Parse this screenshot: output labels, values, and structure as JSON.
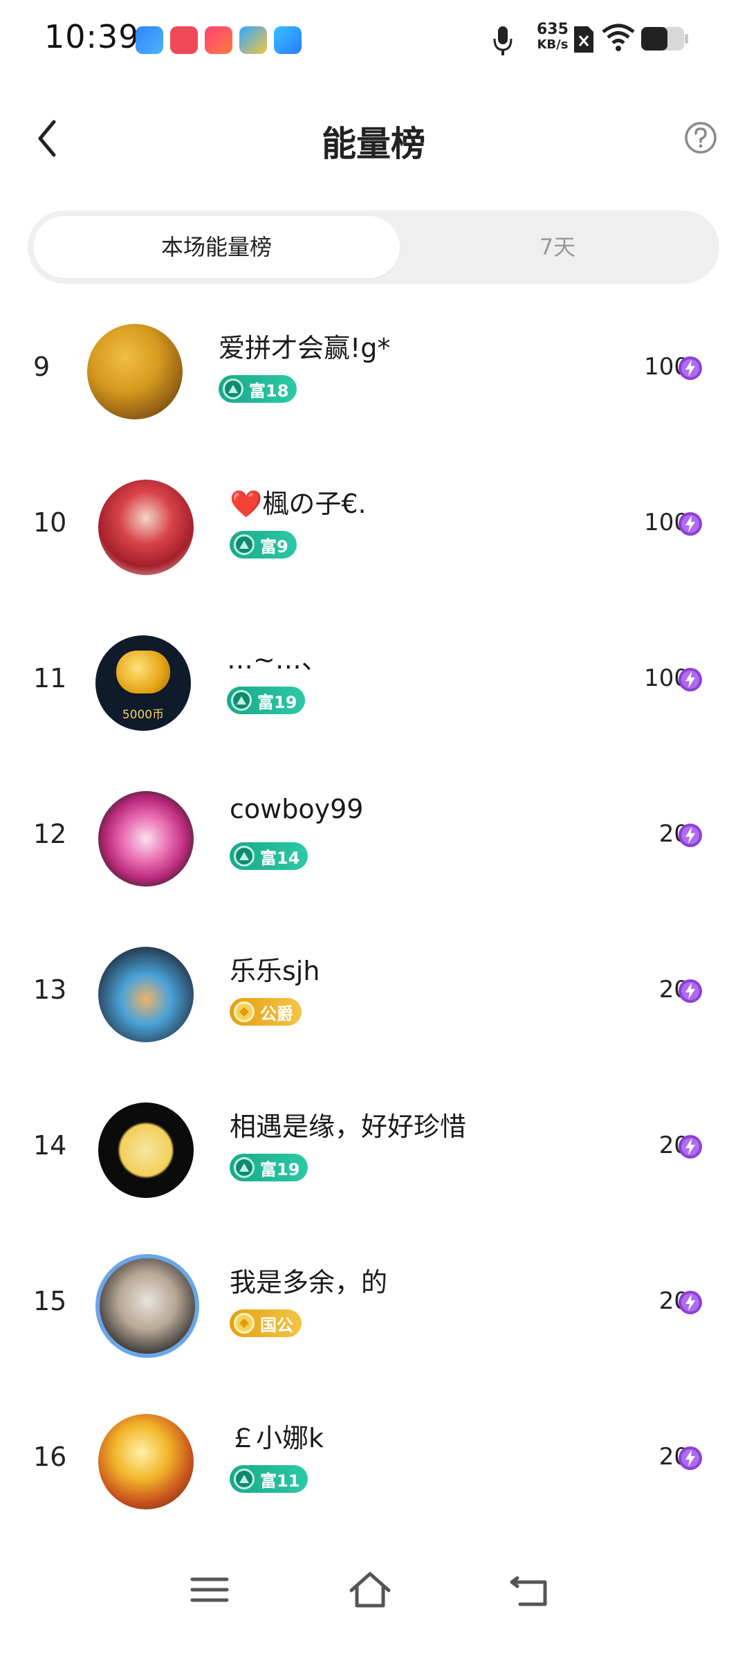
{
  "status_bar": {
    "time": "10:39",
    "net_value": "635",
    "net_unit": "KB/s",
    "app_icons": [
      "app-icon-blue",
      "app-icon-red-video",
      "app-icon-pink-6",
      "app-icon-cloud",
      "app-icon-paper-plane"
    ]
  },
  "header": {
    "title": "能量榜"
  },
  "tabs": [
    {
      "label": "本场能量榜",
      "active": true
    },
    {
      "label": "7天",
      "active": false
    }
  ],
  "colors": {
    "rich_badge": "#1aa98a",
    "noble_badge": "#e6a010",
    "energy": "#8b3fd6"
  },
  "ranking": [
    {
      "rank": "9",
      "name": "爱拼才会赢!g*",
      "badge": "富18",
      "badge_type": "rich",
      "score": "100"
    },
    {
      "rank": "10",
      "name": "❤️楓の子€.",
      "badge": "富9",
      "badge_type": "rich",
      "score": "100"
    },
    {
      "rank": "11",
      "name": "…~…、",
      "badge": "富19",
      "badge_type": "rich",
      "score": "100",
      "avatar_text": "5000币"
    },
    {
      "rank": "12",
      "name": "cowboy99",
      "badge": "富14",
      "badge_type": "rich",
      "score": "20"
    },
    {
      "rank": "13",
      "name": "乐乐sjh",
      "badge": "公爵",
      "badge_type": "noble",
      "score": "20"
    },
    {
      "rank": "14",
      "name": "相遇是缘，好好珍惜",
      "badge": "富19",
      "badge_type": "rich",
      "score": "20"
    },
    {
      "rank": "15",
      "name": "我是多余，的",
      "badge": "国公",
      "badge_type": "noble",
      "score": "20"
    },
    {
      "rank": "16",
      "name": "￡小娜k",
      "badge": "富11",
      "badge_type": "rich",
      "score": "20"
    }
  ]
}
